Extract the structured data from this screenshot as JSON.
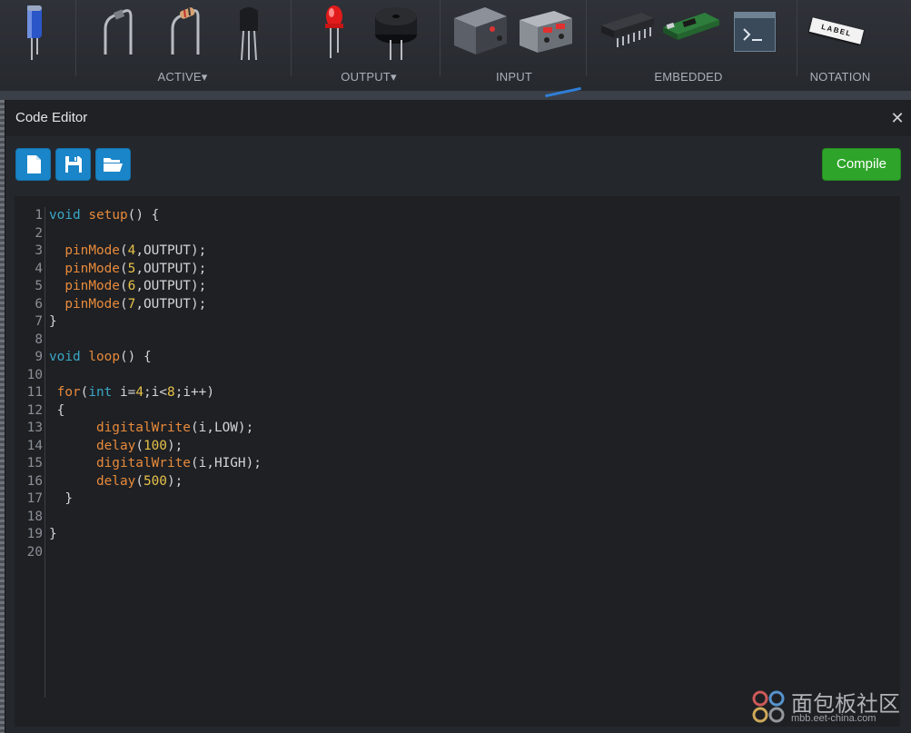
{
  "toolbar": {
    "categories": [
      {
        "label": "ACTIVE",
        "has_dropdown": true
      },
      {
        "label": "OUTPUT",
        "has_dropdown": true
      },
      {
        "label": "INPUT",
        "has_dropdown": false
      },
      {
        "label": "EMBEDDED",
        "has_dropdown": false
      },
      {
        "label": "NOTATION",
        "has_dropdown": false
      }
    ],
    "label_badge": "LABEL",
    "dropdown_glyph": "▾"
  },
  "dialog": {
    "title": "Code Editor",
    "close_glyph": "✕",
    "buttons": {
      "new_file_icon": "file-icon",
      "save_icon": "floppy-disk-icon",
      "open_icon": "folder-open-icon",
      "compile_label": "Compile"
    },
    "colors": {
      "icon_buttons": "#1a85c8",
      "compile": "#2ea52a",
      "keyword": "#3aa7c6",
      "function": "#e88a3a",
      "number": "#e8c24a"
    }
  },
  "code": {
    "lines": [
      [
        {
          "t": "void",
          "c": "kw"
        },
        {
          "t": " "
        },
        {
          "t": "setup",
          "c": "fn"
        },
        {
          "t": "() {"
        }
      ],
      [],
      [
        {
          "t": "  "
        },
        {
          "t": "pinMode",
          "c": "fn"
        },
        {
          "t": "("
        },
        {
          "t": "4",
          "c": "num"
        },
        {
          "t": ",OUTPUT);"
        }
      ],
      [
        {
          "t": "  "
        },
        {
          "t": "pinMode",
          "c": "fn"
        },
        {
          "t": "("
        },
        {
          "t": "5",
          "c": "num"
        },
        {
          "t": ",OUTPUT);"
        }
      ],
      [
        {
          "t": "  "
        },
        {
          "t": "pinMode",
          "c": "fn"
        },
        {
          "t": "("
        },
        {
          "t": "6",
          "c": "num"
        },
        {
          "t": ",OUTPUT);"
        }
      ],
      [
        {
          "t": "  "
        },
        {
          "t": "pinMode",
          "c": "fn"
        },
        {
          "t": "("
        },
        {
          "t": "7",
          "c": "num"
        },
        {
          "t": ",OUTPUT);"
        }
      ],
      [
        {
          "t": "}"
        }
      ],
      [],
      [
        {
          "t": "void",
          "c": "kw"
        },
        {
          "t": " "
        },
        {
          "t": "loop",
          "c": "fn"
        },
        {
          "t": "() {"
        }
      ],
      [],
      [
        {
          "t": " "
        },
        {
          "t": "for",
          "c": "fn"
        },
        {
          "t": "("
        },
        {
          "t": "int",
          "c": "kw"
        },
        {
          "t": " i="
        },
        {
          "t": "4",
          "c": "num"
        },
        {
          "t": ";i<"
        },
        {
          "t": "8",
          "c": "num"
        },
        {
          "t": ";i++)"
        }
      ],
      [
        {
          "t": " {"
        }
      ],
      [
        {
          "t": "      "
        },
        {
          "t": "digitalWrite",
          "c": "fn"
        },
        {
          "t": "(i,LOW);"
        }
      ],
      [
        {
          "t": "      "
        },
        {
          "t": "delay",
          "c": "fn"
        },
        {
          "t": "("
        },
        {
          "t": "100",
          "c": "num"
        },
        {
          "t": ");"
        }
      ],
      [
        {
          "t": "      "
        },
        {
          "t": "digitalWrite",
          "c": "fn"
        },
        {
          "t": "(i,HIGH);"
        }
      ],
      [
        {
          "t": "      "
        },
        {
          "t": "delay",
          "c": "fn"
        },
        {
          "t": "("
        },
        {
          "t": "500",
          "c": "num"
        },
        {
          "t": ");"
        }
      ],
      [
        {
          "t": "  }"
        }
      ],
      [],
      [
        {
          "t": "}"
        }
      ],
      []
    ]
  },
  "watermark": {
    "text": "面包板社区",
    "url": "mbb.eet-china.com"
  }
}
